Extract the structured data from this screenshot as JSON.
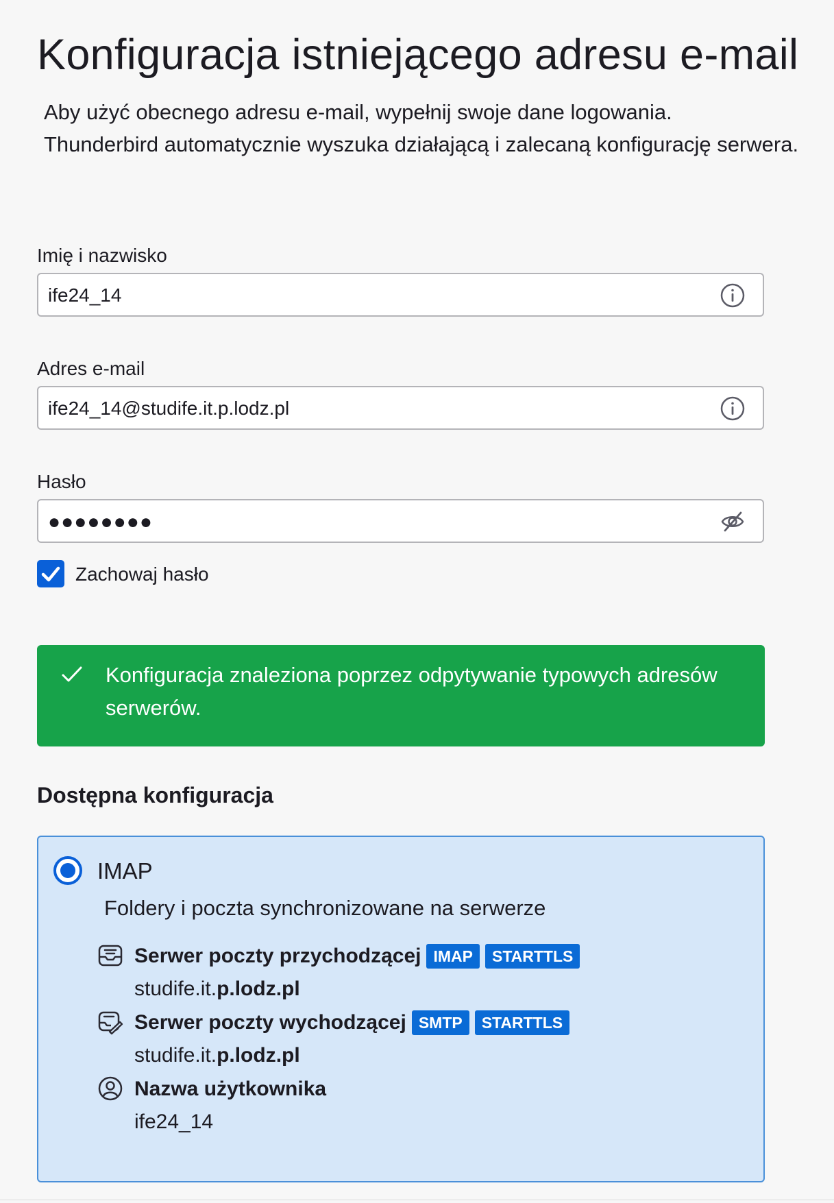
{
  "page": {
    "title": "Konfiguracja istniejącego adresu e-mail",
    "intro_line1": "Aby użyć obecnego adresu e-mail, wypełnij swoje dane logowania.",
    "intro_line2": "Thunderbird automatycznie wyszuka działającą i zalecaną konfigurację serwera."
  },
  "form": {
    "name": {
      "label": "Imię i nazwisko",
      "value": "ife24_14",
      "icon": "info-icon"
    },
    "email": {
      "label": "Adres e-mail",
      "value": "ife24_14@studife.it.p.lodz.pl",
      "icon": "info-icon"
    },
    "password": {
      "label": "Hasło",
      "value": "●●●●●●●●",
      "icon": "eye-slash-icon"
    },
    "remember_password": {
      "label": "Zachowaj hasło",
      "checked": true
    }
  },
  "status": {
    "message": "Konfiguracja znaleziona poprzez odpytywanie typowych adresów serwerów.",
    "icon": "check-icon",
    "color": "#17a34a"
  },
  "config": {
    "section_title": "Dostępna konfiguracja",
    "protocol": "IMAP",
    "protocol_desc": "Foldery i poczta synchronizowane na serwerze",
    "selected": true,
    "incoming": {
      "title": "Serwer poczty przychodzącej",
      "badges": [
        "IMAP",
        "STARTTLS"
      ],
      "host_prefix": "studife.it.",
      "host_domain": "p.lodz.pl",
      "icon": "inbox-icon"
    },
    "outgoing": {
      "title": "Serwer poczty wychodzącej",
      "badges": [
        "SMTP",
        "STARTTLS"
      ],
      "host_prefix": "studife.it.",
      "host_domain": "p.lodz.pl",
      "icon": "outbox-icon"
    },
    "username": {
      "title": "Nazwa użytkownika",
      "value": "ife24_14",
      "icon": "user-icon"
    }
  },
  "colors": {
    "accent": "#0a60d8",
    "badge": "#0a6bd6",
    "card_background": "#d6e7f9",
    "card_border": "#4a90d9",
    "page_background": "#f7f7f7"
  }
}
